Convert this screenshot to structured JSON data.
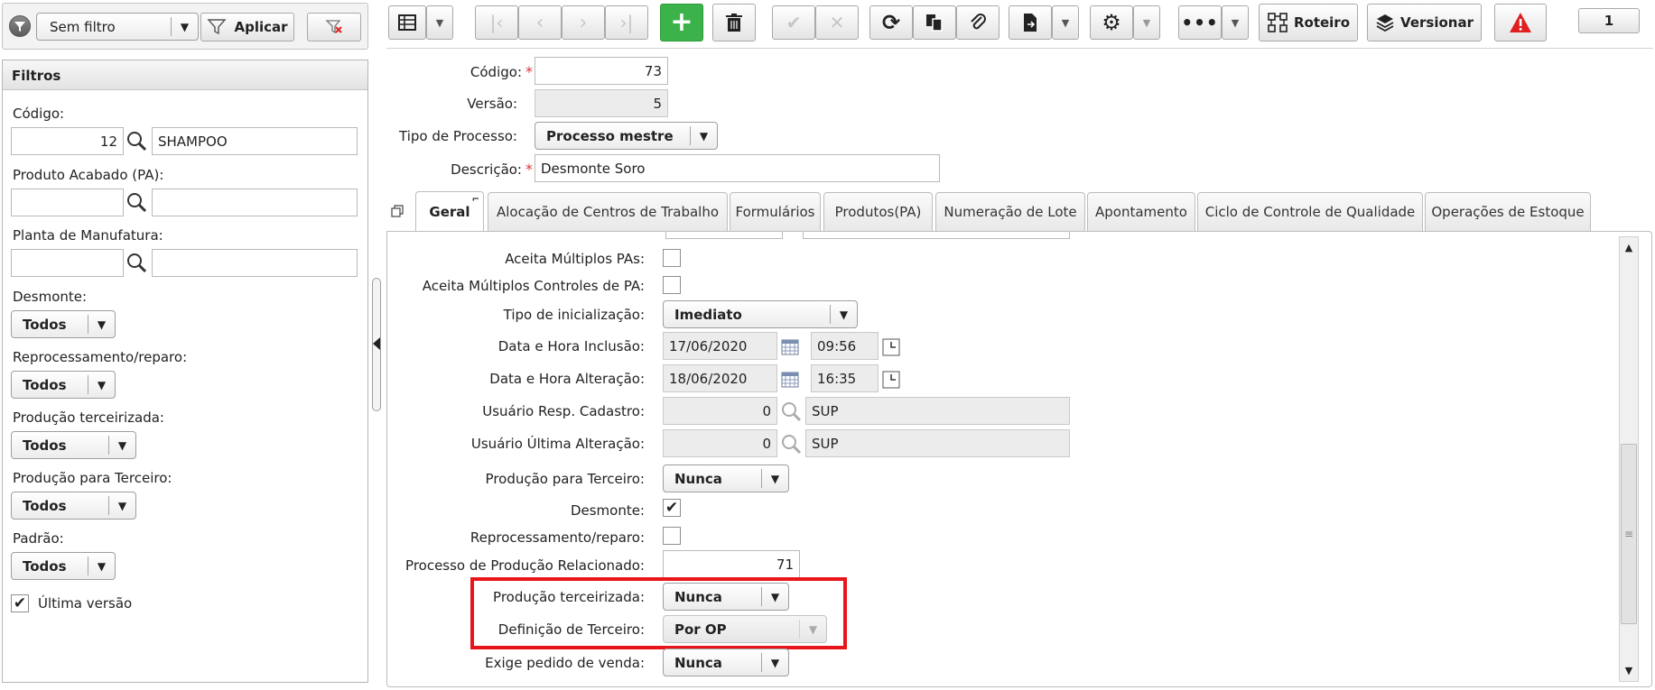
{
  "filter_bar": {
    "filter_select": "Sem filtro",
    "apply_label": "Aplicar"
  },
  "filters": {
    "title": "Filtros",
    "codigo_label": "Código:",
    "codigo_value": "12",
    "codigo_desc": "SHAMPOO",
    "produto_label": "Produto Acabado (PA):",
    "planta_label": "Planta de Manufatura:",
    "desmonte_label": "Desmonte:",
    "desmonte_value": "Todos",
    "reprocess_label": "Reprocessamento/reparo:",
    "reprocess_value": "Todos",
    "terceirizada_label": "Produção terceirizada:",
    "terceirizada_value": "Todos",
    "paraterceiro_label": "Produção para Terceiro:",
    "paraterceiro_value": "Todos",
    "padrao_label": "Padrão:",
    "padrao_value": "Todos",
    "ultima_versao_label": "Última versão",
    "ultima_versao_checked": true
  },
  "toolbar": {
    "roteiro_label": "Roteiro",
    "versionar_label": "Versionar",
    "page_number": "1",
    "add_color": "#3cb34a",
    "alert_color": "#e02020"
  },
  "header_form": {
    "codigo_label": "Código:",
    "codigo_value": "73",
    "versao_label": "Versão:",
    "versao_value": "5",
    "tipo_label": "Tipo de Processo:",
    "tipo_value": "Processo mestre",
    "descricao_label": "Descrição:",
    "descricao_value": "Desmonte Soro"
  },
  "tabs": [
    {
      "label": "Geral"
    },
    {
      "label": "Alocação de Centros de Trabalho"
    },
    {
      "label": "Formulários"
    },
    {
      "label": "Produtos(PA)"
    },
    {
      "label": "Numeração de Lote"
    },
    {
      "label": "Apontamento"
    },
    {
      "label": "Ciclo de Controle de Qualidade"
    },
    {
      "label": "Operações de Estoque"
    }
  ],
  "general": {
    "aceita_pas_label": "Aceita Múltiplos PAs:",
    "aceita_ctrl_label": "Aceita Múltiplos Controles de PA:",
    "tipo_init_label": "Tipo de inicialização:",
    "tipo_init_value": "Imediato",
    "inclusao_label": "Data e Hora Inclusão:",
    "inclusao_date": "17/06/2020",
    "inclusao_time": "09:56",
    "alteracao_label": "Data e Hora Alteração:",
    "alteracao_date": "18/06/2020",
    "alteracao_time": "16:35",
    "usuario_cad_label": "Usuário Resp. Cadastro:",
    "usuario_cad_code": "0",
    "usuario_cad_name": "SUP",
    "usuario_alt_label": "Usuário Última Alteração:",
    "usuario_alt_code": "0",
    "usuario_alt_name": "SUP",
    "prod_terceiro_label": "Produção para Terceiro:",
    "prod_terceiro_value": "Nunca",
    "desmonte_label": "Desmonte:",
    "desmonte_checked": true,
    "reprocess_label": "Reprocessamento/reparo:",
    "processo_rel_label": "Processo de Produção Relacionado:",
    "processo_rel_value": "71",
    "terceirizada_label": "Produção terceirizada:",
    "terceirizada_value": "Nunca",
    "def_terceiro_label": "Definição de Terceiro:",
    "def_terceiro_value": "Por OP",
    "exige_pedido_label": "Exige pedido de venda:",
    "exige_pedido_value": "Nunca",
    "highlight_color": "#e8161b"
  }
}
